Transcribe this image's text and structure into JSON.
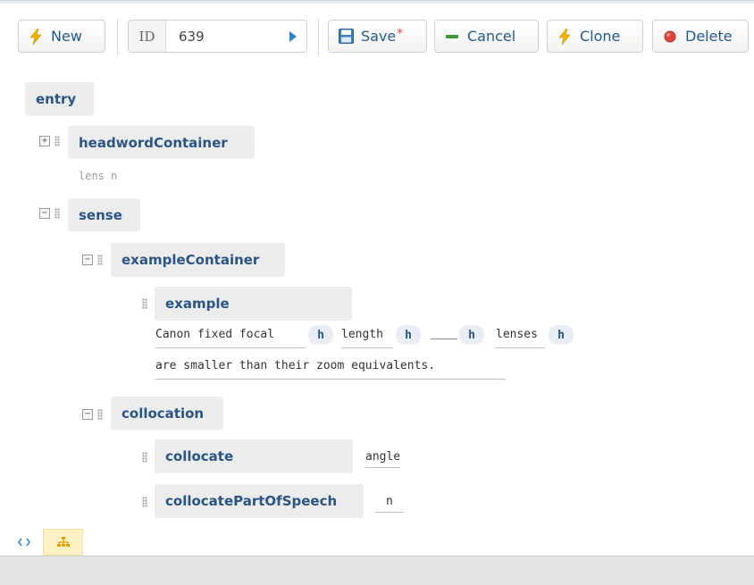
{
  "toolbar": {
    "new_label": "New",
    "id_label": "ID",
    "id_value": "639",
    "save_label": "Save",
    "save_marker": "*",
    "cancel_label": "Cancel",
    "clone_label": "Clone",
    "delete_label": "Delete"
  },
  "tree": {
    "entry": "entry",
    "headword_container": "headwordContainer",
    "headword_preview": "lens n",
    "sense": "sense",
    "example_container": "exampleContainer",
    "example": "example",
    "example_line1": {
      "w1": "Canon fixed focal",
      "h": "h",
      "w2": "length",
      "w3": "lenses"
    },
    "example_line2": "are smaller than their zoom equivalents.",
    "collocation": "collocation",
    "collocate": "collocate",
    "collocate_value": "angle",
    "collocate_pos": "collocatePartOfSpeech",
    "collocate_pos_value": "n"
  },
  "colors": {
    "element_text": "#2a5586",
    "element_bg": "#ececec",
    "accent_orange": "#f0b400",
    "delete_red": "#e0483e",
    "cancel_green": "#3a9a3a"
  },
  "icons": {
    "new": "lightning-icon",
    "next": "play-arrow-icon",
    "save": "floppy-disk-icon",
    "cancel": "minus-icon",
    "clone": "lightning-icon",
    "delete": "red-circle-icon",
    "code_view": "code-icon",
    "tree_view": "hierarchy-icon"
  }
}
